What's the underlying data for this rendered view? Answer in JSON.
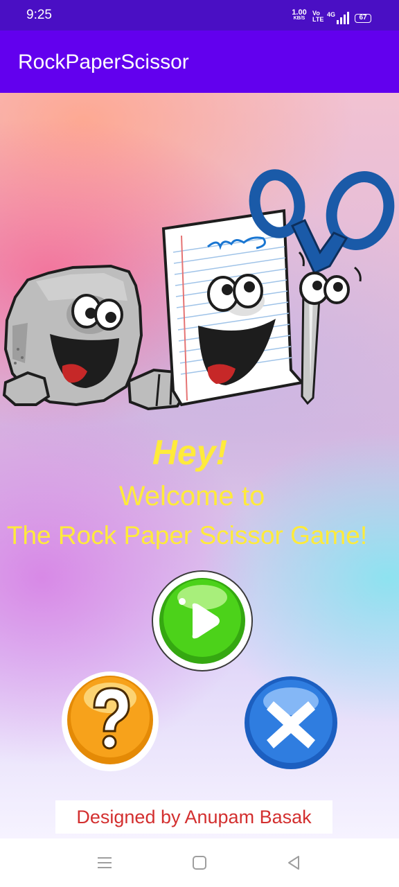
{
  "status_bar": {
    "time": "9:25",
    "net_speed": "1.00",
    "net_unit": "KB/S",
    "volte": "Vo",
    "lte": "LTE",
    "network": "4G",
    "battery": "67"
  },
  "app_bar": {
    "title": "RockPaperScissor"
  },
  "welcome": {
    "hey": "Hey!",
    "line1": "Welcome to",
    "line2": "The Rock Paper Scissor Game!"
  },
  "buttons": {
    "play_icon": "play-icon",
    "help_icon": "question-icon",
    "exit_icon": "close-icon"
  },
  "footer": {
    "credit": "Designed by Anupam Basak"
  },
  "colors": {
    "status_bar": "#4a0fc4",
    "app_bar": "#6200ee",
    "welcome_text": "#ffeb3b",
    "credit_text": "#d32f2f",
    "play_green": "#4cd21a",
    "help_orange": "#f7a21b",
    "exit_blue": "#2f7de0"
  }
}
